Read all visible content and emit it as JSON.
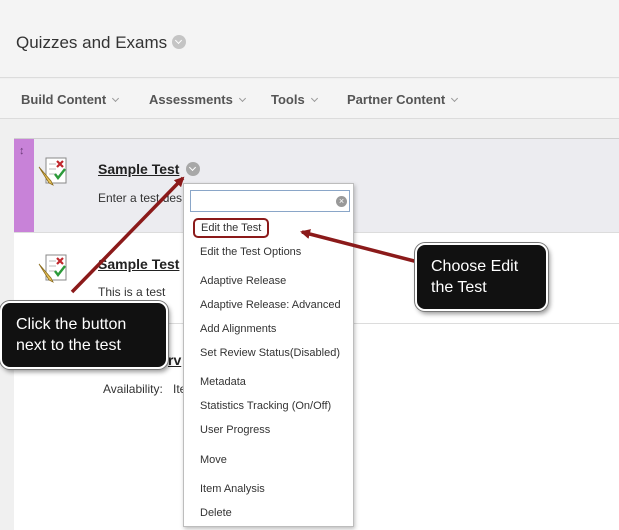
{
  "page": {
    "title": "Quizzes and Exams"
  },
  "action_bar": {
    "items": [
      {
        "label": "Build Content"
      },
      {
        "label": "Assessments"
      },
      {
        "label": "Tools"
      },
      {
        "label": "Partner Content"
      }
    ]
  },
  "content": {
    "items": [
      {
        "title": "Sample Test",
        "description": "Enter a test des"
      },
      {
        "title": "Sample Test",
        "description": "This is a test"
      },
      {
        "title": "rv",
        "availability_label": "Availability:",
        "availability_value": "Ite"
      }
    ]
  },
  "context_menu": {
    "search": {
      "value": "",
      "placeholder": ""
    },
    "items": [
      {
        "label": "Edit the Test",
        "highlighted": true
      },
      {
        "label": "Edit the Test Options"
      },
      {
        "label": "Adaptive Release"
      },
      {
        "label": "Adaptive Release: Advanced"
      },
      {
        "label": "Add Alignments"
      },
      {
        "label": "Set Review Status(Disabled)"
      },
      {
        "label": "Metadata"
      },
      {
        "label": "Statistics Tracking (On/Off)"
      },
      {
        "label": "User Progress"
      },
      {
        "label": "Move"
      },
      {
        "label": "Item Analysis"
      },
      {
        "label": "Delete"
      }
    ]
  },
  "callouts": {
    "edit_test": "Choose Edit the Test",
    "button": "Click the button next to the test"
  },
  "colors": {
    "selected_grip": "#c882d8",
    "annotation_arrow": "#8b1a1a",
    "callout_bg": "#111111"
  }
}
